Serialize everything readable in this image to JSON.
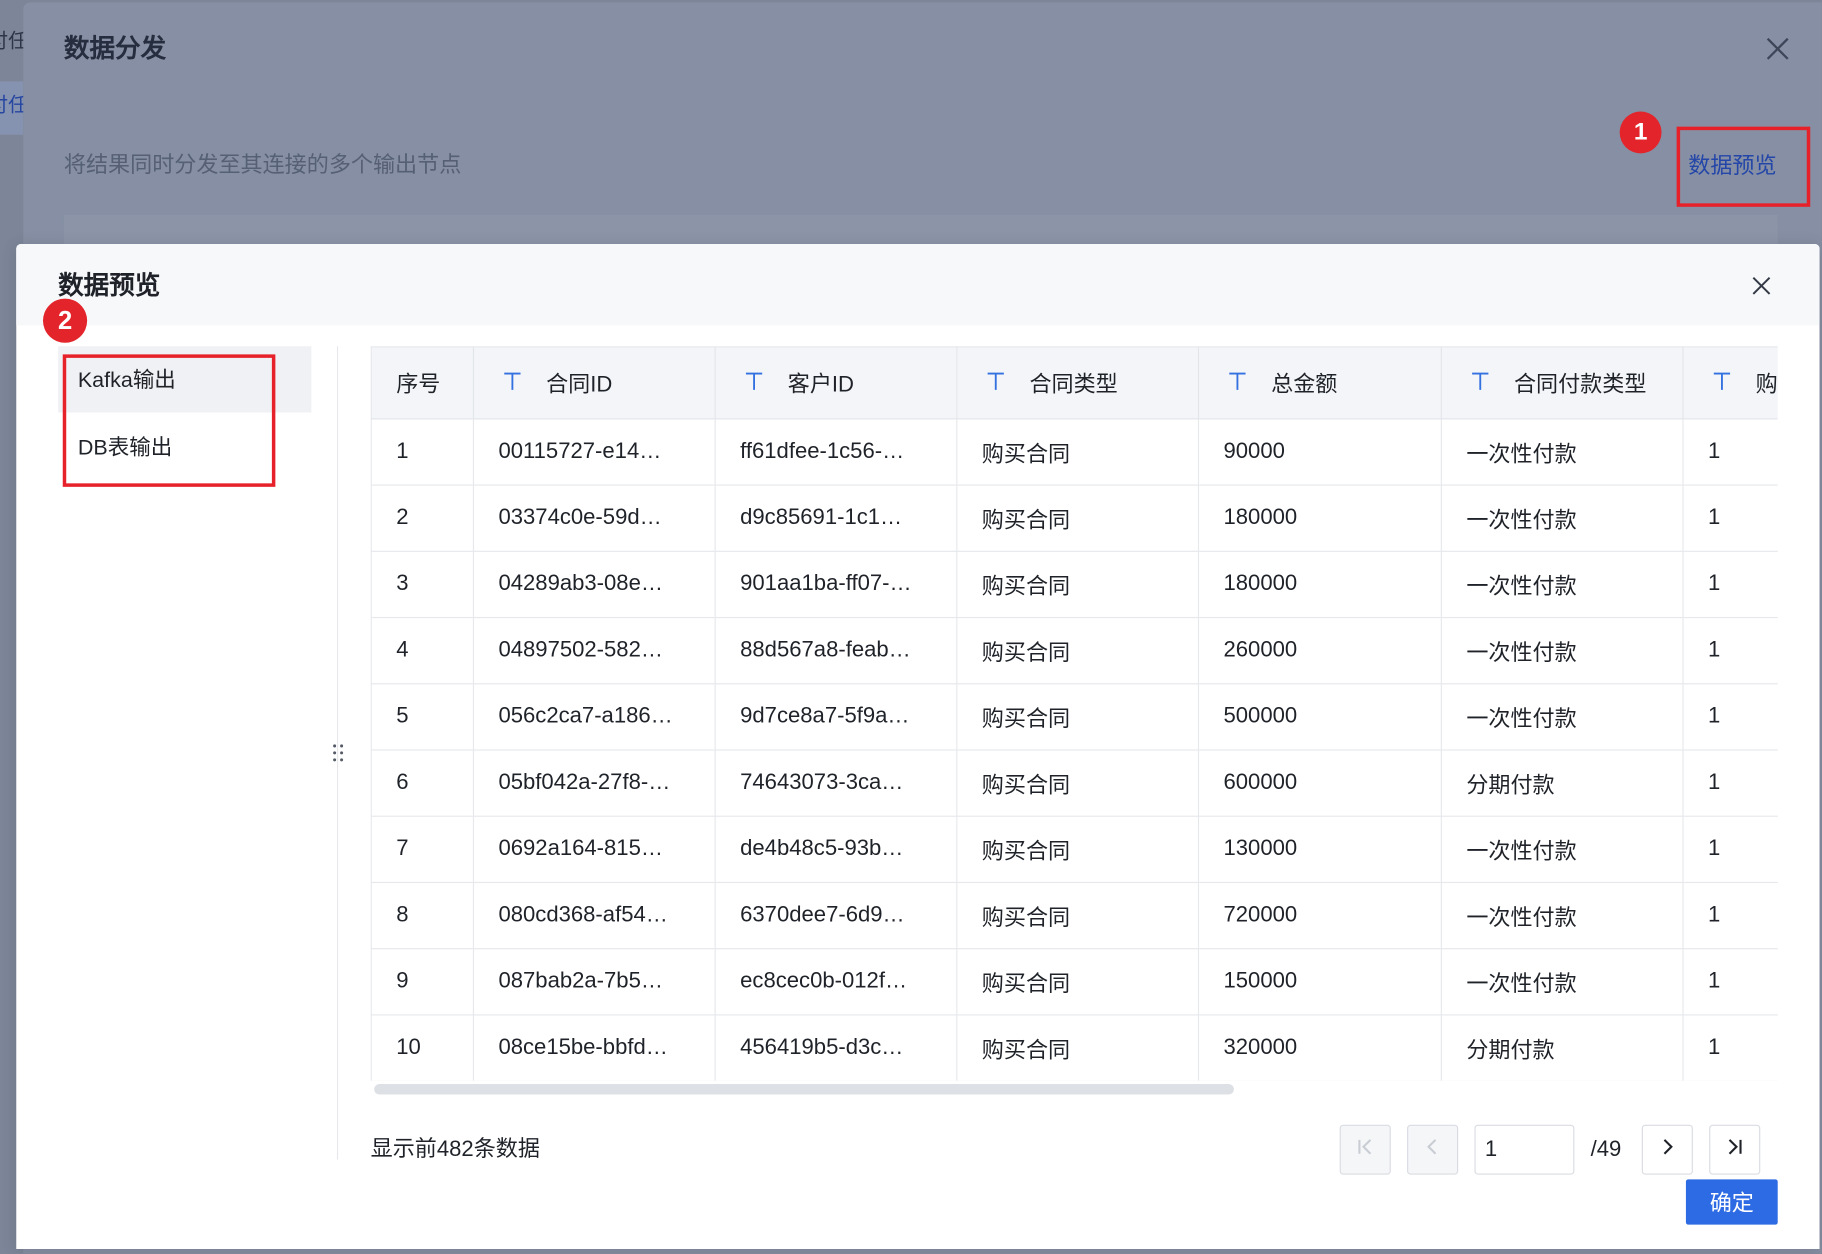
{
  "background_page": {
    "sidebar_fragment_1": "付任",
    "sidebar_fragment_2": "付任"
  },
  "distribution_dialog": {
    "title": "数据分发",
    "description": "将结果同时分发至其连接的多个输出节点",
    "preview_link": "数据预览"
  },
  "annotations": {
    "badge_1": "1",
    "badge_2": "2"
  },
  "preview_dialog": {
    "title": "数据预览",
    "outputs": [
      {
        "label": "Kafka输出",
        "selected": true
      },
      {
        "label": "DB表输出",
        "selected": false
      }
    ],
    "table": {
      "columns": [
        {
          "label": "序号",
          "type_icon": null
        },
        {
          "label": "合同ID",
          "type_icon": "text-type-icon"
        },
        {
          "label": "客户ID",
          "type_icon": "text-type-icon"
        },
        {
          "label": "合同类型",
          "type_icon": "text-type-icon"
        },
        {
          "label": "总金额",
          "type_icon": "text-type-icon"
        },
        {
          "label": "合同付款类型",
          "type_icon": "text-type-icon"
        },
        {
          "label": "购",
          "type_icon": "text-type-icon"
        }
      ],
      "rows": [
        [
          "1",
          "00115727-e14…",
          "ff61dfee-1c56-…",
          "购买合同",
          "90000",
          "一次性付款",
          "1"
        ],
        [
          "2",
          "03374c0e-59d…",
          "d9c85691-1c1…",
          "购买合同",
          "180000",
          "一次性付款",
          "1"
        ],
        [
          "3",
          "04289ab3-08e…",
          "901aa1ba-ff07-…",
          "购买合同",
          "180000",
          "一次性付款",
          "1"
        ],
        [
          "4",
          "04897502-582…",
          "88d567a8-feab…",
          "购买合同",
          "260000",
          "一次性付款",
          "1"
        ],
        [
          "5",
          "056c2ca7-a186…",
          "9d7ce8a7-5f9a…",
          "购买合同",
          "500000",
          "一次性付款",
          "1"
        ],
        [
          "6",
          "05bf042a-27f8-…",
          "74643073-3ca…",
          "购买合同",
          "600000",
          "分期付款",
          "1"
        ],
        [
          "7",
          "0692a164-815…",
          "de4b48c5-93b…",
          "购买合同",
          "130000",
          "一次性付款",
          "1"
        ],
        [
          "8",
          "080cd368-af54…",
          "6370dee7-6d9…",
          "购买合同",
          "720000",
          "一次性付款",
          "1"
        ],
        [
          "9",
          "087bab2a-7b5…",
          "ec8cec0b-012f…",
          "购买合同",
          "150000",
          "一次性付款",
          "1"
        ],
        [
          "10",
          "08ce15be-bbfd…",
          "456419b5-d3c…",
          "购买合同",
          "320000",
          "分期付款",
          "1"
        ]
      ]
    },
    "footer": {
      "summary": "显示前482条数据",
      "current_page": "1",
      "total_pages": "/49",
      "confirm_label": "确定"
    },
    "pagination": {
      "first_disabled": true,
      "prev_disabled": true,
      "next_disabled": false,
      "last_disabled": false
    }
  },
  "colors": {
    "primary": "#2d6be4",
    "highlight_red": "#e62129",
    "type_icon": "#3370e0",
    "text": "#1f2329",
    "mask": "#868fa3"
  },
  "icons": {
    "close": "close-icon",
    "column_type": "text-type-icon",
    "resize": "drag-handle-icon",
    "first_page": "first-page-icon",
    "prev_page": "prev-page-icon",
    "next_page": "next-page-icon",
    "last_page": "last-page-icon"
  }
}
